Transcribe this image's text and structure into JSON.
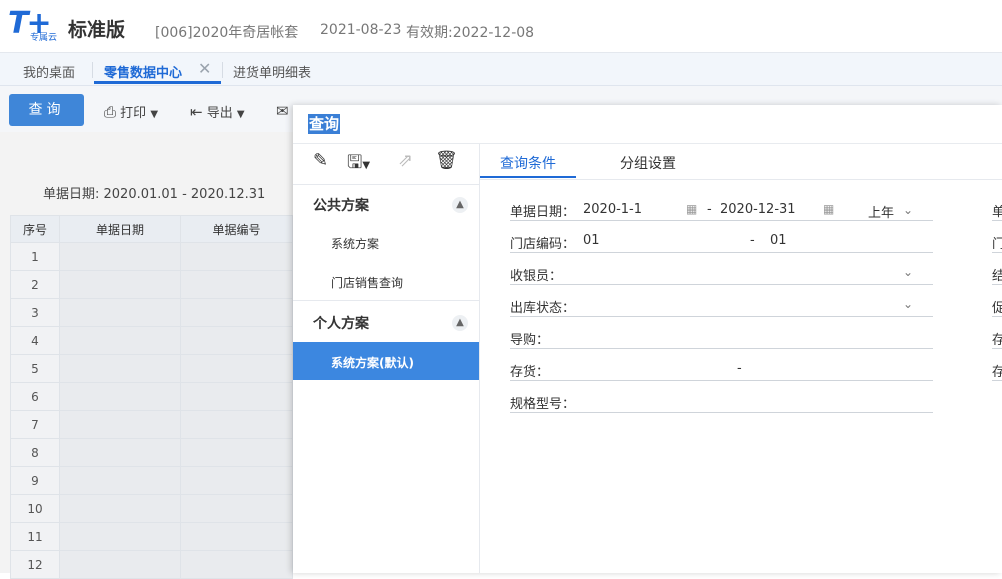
{
  "header": {
    "logo_mark": "T+",
    "logo_sub": "专属云",
    "logo_name": "标准版",
    "account": "[006]2020年奇居帐套",
    "date": "2021-08-23",
    "valid": "有效期:2022-12-08"
  },
  "tabs": [
    {
      "label": "我的桌面"
    },
    {
      "label": "零售数据中心"
    },
    {
      "label": "进货单明细表"
    }
  ],
  "toolbar": {
    "query": "查询",
    "print": "打印",
    "export": "导出"
  },
  "report": {
    "date_range": "单据日期:  2020.01.01 - 2020.12.31",
    "columns": [
      "序号",
      "单据日期",
      "单据编号"
    ],
    "rows": [
      "1",
      "2",
      "3",
      "4",
      "5",
      "6",
      "7",
      "8",
      "9",
      "10",
      "11",
      "12"
    ]
  },
  "dialog": {
    "title": "查询",
    "public_group": "公共方案",
    "public_plans": [
      "系统方案",
      "门店销售查询"
    ],
    "personal_group": "个人方案",
    "personal_selected": "系统方案(默认)",
    "tabs": [
      "查询条件",
      "分组设置"
    ],
    "form": {
      "date_label": "单据日期：",
      "date_from": "2020-1-1",
      "date_sep": "-",
      "date_to": "2020-12-31",
      "period": "上年",
      "store_label": "门店编码：",
      "store_from": "01",
      "store_sep": "-",
      "store_to": "01",
      "cashier_label": "收银员：",
      "outstatus_label": "出库状态：",
      "guide_label": "导购：",
      "stock_label": "存货：",
      "stock_sep": "-",
      "spec_label": "规格型号："
    },
    "right_cut": [
      "单",
      "门",
      "结",
      "促",
      "存",
      "存"
    ]
  },
  "colors": {
    "brand": "#1f6ad6",
    "primary_button": "#3f86d8",
    "selected_plan": "#3c87e0"
  }
}
